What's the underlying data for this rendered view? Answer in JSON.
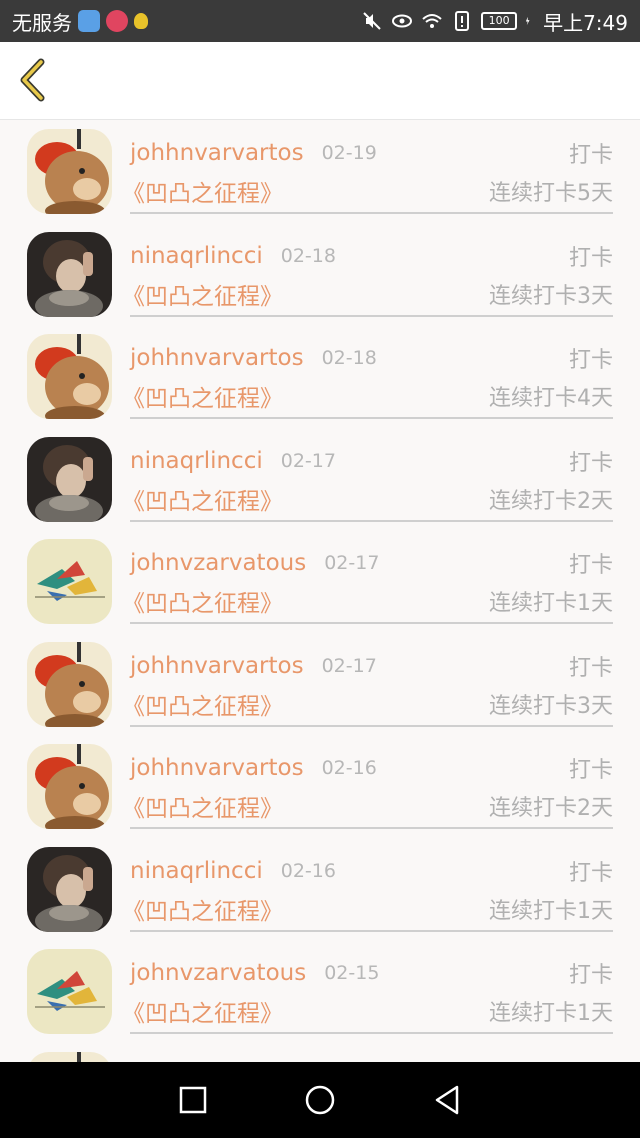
{
  "status": {
    "carrier": "无服务",
    "battery": "100",
    "time": "早上7:49"
  },
  "list": {
    "items": [
      {
        "avatar": "rabbit",
        "user": "johhnvarvartos",
        "date": "02-19",
        "action": "打卡",
        "book": "《凹凸之征程》",
        "streak": "连续打卡5天"
      },
      {
        "avatar": "person",
        "user": "ninaqrlincci",
        "date": "02-18",
        "action": "打卡",
        "book": "《凹凸之征程》",
        "streak": "连续打卡3天"
      },
      {
        "avatar": "rabbit",
        "user": "johhnvarvartos",
        "date": "02-18",
        "action": "打卡",
        "book": "《凹凸之征程》",
        "streak": "连续打卡4天"
      },
      {
        "avatar": "person",
        "user": "ninaqrlincci",
        "date": "02-17",
        "action": "打卡",
        "book": "《凹凸之征程》",
        "streak": "连续打卡2天"
      },
      {
        "avatar": "crane",
        "user": "johnvzarvatous",
        "date": "02-17",
        "action": "打卡",
        "book": "《凹凸之征程》",
        "streak": "连续打卡1天"
      },
      {
        "avatar": "rabbit",
        "user": "johhnvarvartos",
        "date": "02-17",
        "action": "打卡",
        "book": "《凹凸之征程》",
        "streak": "连续打卡3天"
      },
      {
        "avatar": "rabbit",
        "user": "johhnvarvartos",
        "date": "02-16",
        "action": "打卡",
        "book": "《凹凸之征程》",
        "streak": "连续打卡2天"
      },
      {
        "avatar": "person",
        "user": "ninaqrlincci",
        "date": "02-16",
        "action": "打卡",
        "book": "《凹凸之征程》",
        "streak": "连续打卡1天"
      },
      {
        "avatar": "crane",
        "user": "johnvzarvatous",
        "date": "02-15",
        "action": "打卡",
        "book": "《凹凸之征程》",
        "streak": "连续打卡1天"
      },
      {
        "avatar": "rabbit",
        "user": "",
        "date": "",
        "action": "",
        "book": "",
        "streak": ""
      }
    ]
  },
  "colors": {
    "accent": "#e8976a",
    "muted": "#b0b0b0",
    "divider": "#cfcfcf"
  }
}
